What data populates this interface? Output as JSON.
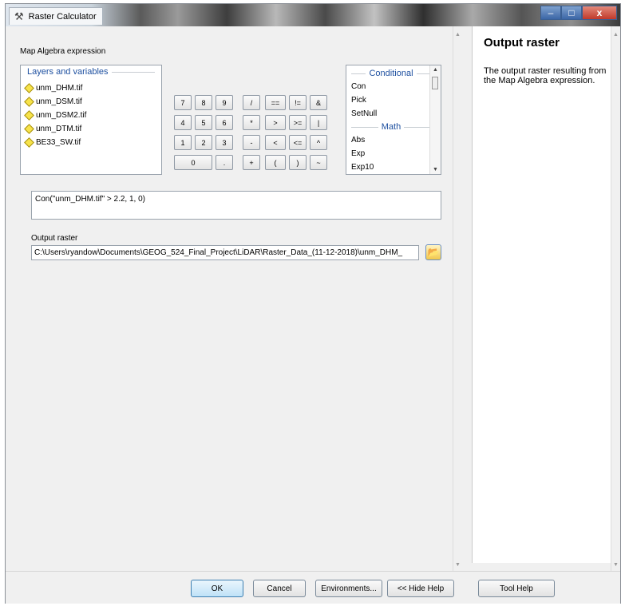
{
  "window": {
    "title": "Raster Calculator",
    "icon": "hammer-icon",
    "controls": {
      "minimize": "–",
      "maximize": "□",
      "close": "x"
    }
  },
  "map_algebra": {
    "label": "Map Algebra expression",
    "layers_header": "Layers and variables",
    "layers": [
      "unm_DHM.tif",
      "unm_DSM.tif",
      "unm_DSM2.tif",
      "unm_DTM.tif",
      "BE33_SW.tif"
    ],
    "buttons_row1": [
      "7",
      "8",
      "9",
      "/",
      "==",
      "!=",
      "&"
    ],
    "buttons_row2": [
      "4",
      "5",
      "6",
      "*",
      ">",
      ">=",
      "|"
    ],
    "buttons_row3": [
      "1",
      "2",
      "3",
      "-",
      "<",
      "<=",
      "^"
    ],
    "buttons_row4": [
      "0",
      ".",
      "+",
      "(",
      ")",
      "~"
    ],
    "functions": {
      "conditional_header": "Conditional",
      "conditional": [
        "Con",
        "Pick",
        "SetNull"
      ],
      "math_header": "Math",
      "math": [
        "Abs",
        "Exp",
        "Exp10"
      ]
    },
    "expression": "Con(\"unm_DHM.tif\" > 2.2, 1, 0)"
  },
  "output": {
    "label": "Output raster",
    "value": "C:\\Users\\ryandow\\Documents\\GEOG_524_Final_Project\\LiDAR\\Raster_Data_(11-12-2018)\\unm_DHM_",
    "browse_icon": "folder-open-icon"
  },
  "help": {
    "title": "Output raster",
    "body": "The output raster resulting from the Map Algebra expression."
  },
  "footer": {
    "ok": "OK",
    "cancel": "Cancel",
    "environments": "Environments...",
    "hide_help": "<< Hide Help",
    "tool_help": "Tool Help"
  }
}
